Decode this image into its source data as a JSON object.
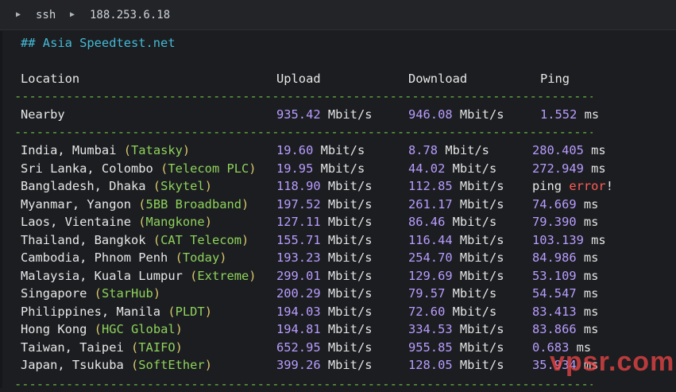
{
  "titlebar": {
    "protocol": "ssh",
    "host": "188.253.6.18"
  },
  "output": {
    "heading": "## Asia Speedtest.net",
    "columns": {
      "location": "Location",
      "upload": "Upload",
      "download": "Download",
      "ping": "Ping"
    },
    "separator": "-----------------------------------------------------------------------------------------------",
    "nearby": {
      "location": "Nearby",
      "upload": "935.42",
      "upload_unit": "Mbit/s",
      "download": "946.08",
      "download_unit": "Mbit/s",
      "ping": "1.552",
      "ping_unit": "ms"
    },
    "rows": [
      {
        "city": "India, Mumbai",
        "provider": "Tatasky",
        "upload": "19.60",
        "download": "8.78",
        "ping": "280.405"
      },
      {
        "city": "Sri Lanka, Colombo",
        "provider": "Telecom PLC",
        "upload": "19.95",
        "download": "44.02",
        "ping": "272.949"
      },
      {
        "city": "Bangladesh, Dhaka",
        "provider": "Skytel",
        "upload": "118.90",
        "download": "112.85",
        "ping_text": "ping",
        "ping_error": "error",
        "ping_bang": "!"
      },
      {
        "city": "Myanmar, Yangon",
        "provider": "5BB Broadband",
        "upload": "197.52",
        "download": "261.17",
        "ping": "74.669"
      },
      {
        "city": "Laos, Vientaine",
        "provider": "Mangkone",
        "upload": "127.11",
        "download": "86.46",
        "ping": "79.390"
      },
      {
        "city": "Thailand, Bangkok",
        "provider": "CAT Telecom",
        "upload": "155.71",
        "download": "116.44",
        "ping": "103.139"
      },
      {
        "city": "Cambodia, Phnom Penh",
        "provider": "Today",
        "upload": "193.23",
        "download": "254.70",
        "ping": "84.986"
      },
      {
        "city": "Malaysia, Kuala Lumpur",
        "provider": "Extreme",
        "upload": "299.01",
        "download": "129.69",
        "ping": "53.109"
      },
      {
        "city": "Singapore",
        "provider": "StarHub",
        "upload": "200.29",
        "download": "79.57",
        "ping": "54.547"
      },
      {
        "city": "Philippines, Manila",
        "provider": "PLDT",
        "upload": "194.03",
        "download": "72.60",
        "ping": "83.413"
      },
      {
        "city": "Hong Kong",
        "provider": "HGC Global",
        "upload": "194.81",
        "download": "334.53",
        "ping": "83.866"
      },
      {
        "city": "Taiwan, Taipei",
        "provider": "TAIFO",
        "upload": "652.95",
        "download": "955.85",
        "ping": "0.683"
      },
      {
        "city": "Japan, Tsukuba",
        "provider": "SoftEther",
        "upload": "399.26",
        "download": "128.05",
        "ping": "35.934"
      }
    ],
    "unit_speed": "Mbit/s",
    "unit_ping": "ms"
  },
  "watermark": "vpsr.com"
}
